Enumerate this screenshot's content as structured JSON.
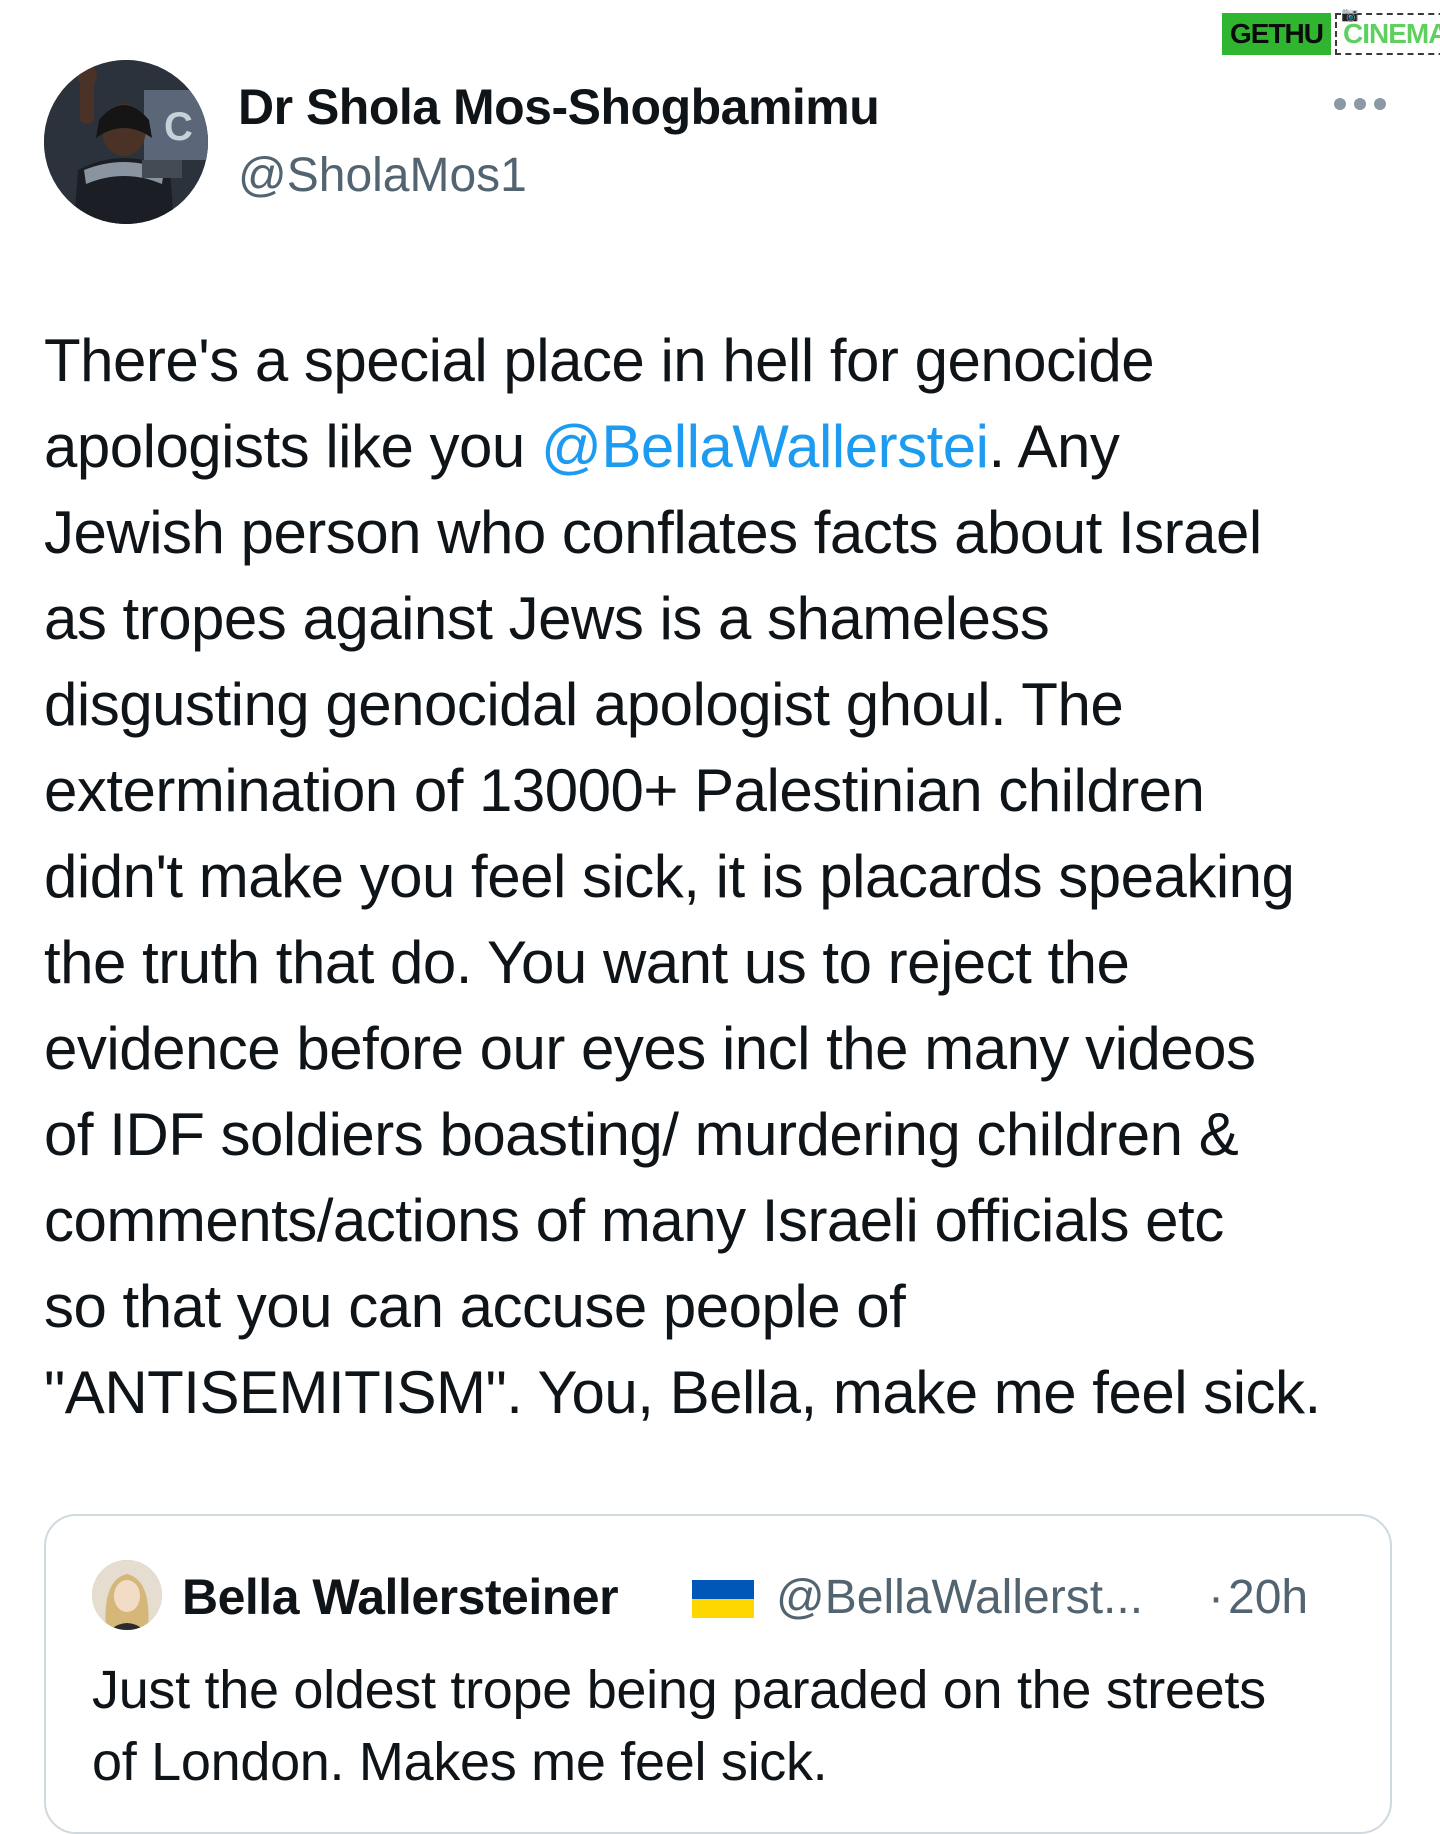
{
  "watermark": {
    "left": "GETHU",
    "right": "CINEMA",
    "colors": {
      "primary": "#2fb52f",
      "secondary": "#5fd05f"
    }
  },
  "tweet": {
    "author": {
      "display_name": "Dr Shola Mos-Shogbamimu",
      "handle": "@SholaMos1",
      "avatar_icon": "profile-photo"
    },
    "more_icon": "more-horizontal-icon",
    "text_lines": [
      [
        {
          "t": "There's a special place in hell for genocide"
        }
      ],
      [
        {
          "t": "apologists like you "
        },
        {
          "t": "@BellaWallerstei",
          "mention": true
        },
        {
          "t": ". Any"
        }
      ],
      [
        {
          "t": "Jewish person who conflates facts about Israel"
        }
      ],
      [
        {
          "t": "as tropes against Jews is a shameless"
        }
      ],
      [
        {
          "t": "disgusting genocidal apologist ghoul. The"
        }
      ],
      [
        {
          "t": "extermination of 13000+ Palestinian children"
        }
      ],
      [
        {
          "t": "didn't make you feel sick, it is placards speaking"
        }
      ],
      [
        {
          "t": "the truth that do. You want us to reject the"
        }
      ],
      [
        {
          "t": "evidence before our eyes incl the many videos"
        }
      ],
      [
        {
          "t": "of IDF soldiers boasting/ murdering children &"
        }
      ],
      [
        {
          "t": "comments/actions of many Israeli officials etc"
        }
      ],
      [
        {
          "t": "so that you can accuse people of"
        }
      ],
      [
        {
          "t": "\"ANTISEMITISM\". You, Bella, make me feel sick."
        }
      ]
    ]
  },
  "quoted_tweet": {
    "display_name": "Bella Wallersteiner",
    "flag_icon": "ukraine-flag-icon",
    "handle": "@BellaWallerst...",
    "separator": "·",
    "time": "20h",
    "text_lines": [
      "Just the oldest trope being paraded on the streets",
      "of London. Makes me feel sick."
    ]
  },
  "colors": {
    "text": "#0f1419",
    "secondary": "#536471",
    "link": "#1d9bf0",
    "border": "#cfd9de"
  }
}
